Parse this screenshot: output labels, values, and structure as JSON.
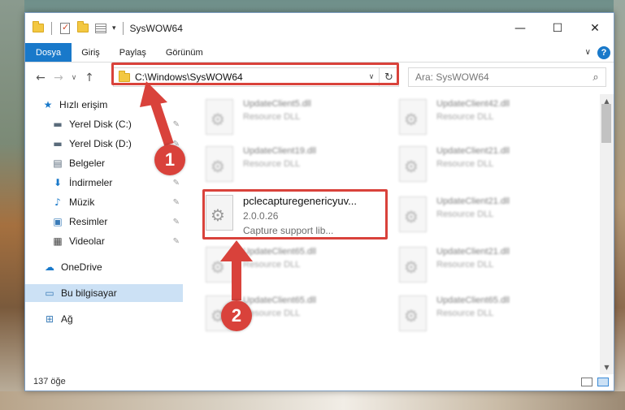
{
  "window": {
    "title": "SysWOW64",
    "minimize_glyph": "—",
    "maximize_glyph": "☐",
    "close_glyph": "✕"
  },
  "ribbon": {
    "tabs": [
      "Dosya",
      "Giriş",
      "Paylaş",
      "Görünüm"
    ],
    "expand_glyph": "∨",
    "help_glyph": "?"
  },
  "navigation": {
    "back_glyph": "←",
    "forward_glyph": "→",
    "recent_glyph": "∨",
    "up_glyph": "↑",
    "address": "C:\\Windows\\SysWOW64",
    "refresh_glyph": "↻",
    "address_dropdown_glyph": "∨",
    "search_placeholder": "Ara: SysWOW64",
    "search_glyph": "⌕"
  },
  "sidebar": {
    "items": [
      {
        "label": "Hızlı erişim",
        "icon": "star-icon",
        "pinned": false
      },
      {
        "label": "Yerel Disk (C:)",
        "icon": "drive-icon",
        "pinned": true
      },
      {
        "label": "Yerel Disk (D:)",
        "icon": "drive-icon",
        "pinned": true
      },
      {
        "label": "Belgeler",
        "icon": "documents-icon",
        "pinned": true
      },
      {
        "label": "İndirmeler",
        "icon": "download-icon",
        "pinned": true
      },
      {
        "label": "Müzik",
        "icon": "music-icon",
        "pinned": true
      },
      {
        "label": "Resimler",
        "icon": "pictures-icon",
        "pinned": true
      },
      {
        "label": "Videolar",
        "icon": "videos-icon",
        "pinned": true
      },
      {
        "label": "OneDrive",
        "icon": "cloud-icon",
        "pinned": false
      },
      {
        "label": "Bu bilgisayar",
        "icon": "computer-icon",
        "pinned": false,
        "selected": true
      },
      {
        "label": "Ağ",
        "icon": "network-icon",
        "pinned": false
      }
    ],
    "pin_glyph": "📌"
  },
  "files": {
    "left_column": [
      {
        "name": "UpdateClient5.dll",
        "desc": "Resource DLL"
      },
      {
        "name": "UpdateClient19.dll",
        "desc": "Resource DLL"
      },
      {
        "name": "pclecapturegenericyuv...",
        "version": "2.0.0.26",
        "desc": "Capture support lib...",
        "focused": true
      },
      {
        "name": "UpdateClient65.dll",
        "desc": "Resource DLL"
      },
      {
        "name": "UpdateClient65.dll",
        "desc": "Resource DLL"
      }
    ],
    "right_column": [
      {
        "name": "UpdateClient42.dll",
        "desc": "Resource DLL"
      },
      {
        "name": "UpdateClient21.dll",
        "desc": "Resource DLL"
      },
      {
        "name": "UpdateClient21.dll",
        "desc": "Resource DLL"
      },
      {
        "name": "UpdateClient21.dll",
        "desc": "Resource DLL"
      },
      {
        "name": "UpdateClient65.dll",
        "desc": "Resource DLL"
      }
    ]
  },
  "status": {
    "item_count": "137 öğe"
  },
  "annotations": {
    "step1": "1",
    "step2": "2",
    "color": "#d9423b"
  }
}
